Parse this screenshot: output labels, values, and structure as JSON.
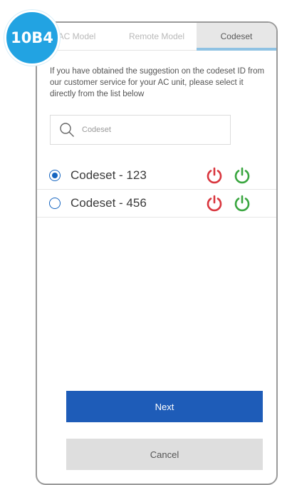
{
  "badge": {
    "label": "10B4",
    "color": "#22a3e2"
  },
  "tabs": [
    {
      "label": "AC Model",
      "active": false
    },
    {
      "label": "Remote Model",
      "active": false
    },
    {
      "label": "Codeset",
      "active": true
    }
  ],
  "instructions": "If you have obtained the suggestion on the codeset ID from our customer service for your AC unit, please select it directly from the list below",
  "search": {
    "icon": "search-icon",
    "placeholder": "Codeset",
    "value": ""
  },
  "codesets": [
    {
      "label": "Codeset - 123",
      "selected": true,
      "power_off_icon": "power-icon-red",
      "power_on_icon": "power-icon-green"
    },
    {
      "label": "Codeset - 456",
      "selected": false,
      "power_off_icon": "power-icon-red",
      "power_on_icon": "power-icon-green"
    }
  ],
  "buttons": {
    "next_label": "Next",
    "cancel_label": "Cancel"
  },
  "colors": {
    "primary": "#1e5cb8",
    "radio": "#1565c0",
    "power_red": "#d9363e",
    "power_green": "#3aa640",
    "tab_active_underline": "#8fc2e3"
  }
}
